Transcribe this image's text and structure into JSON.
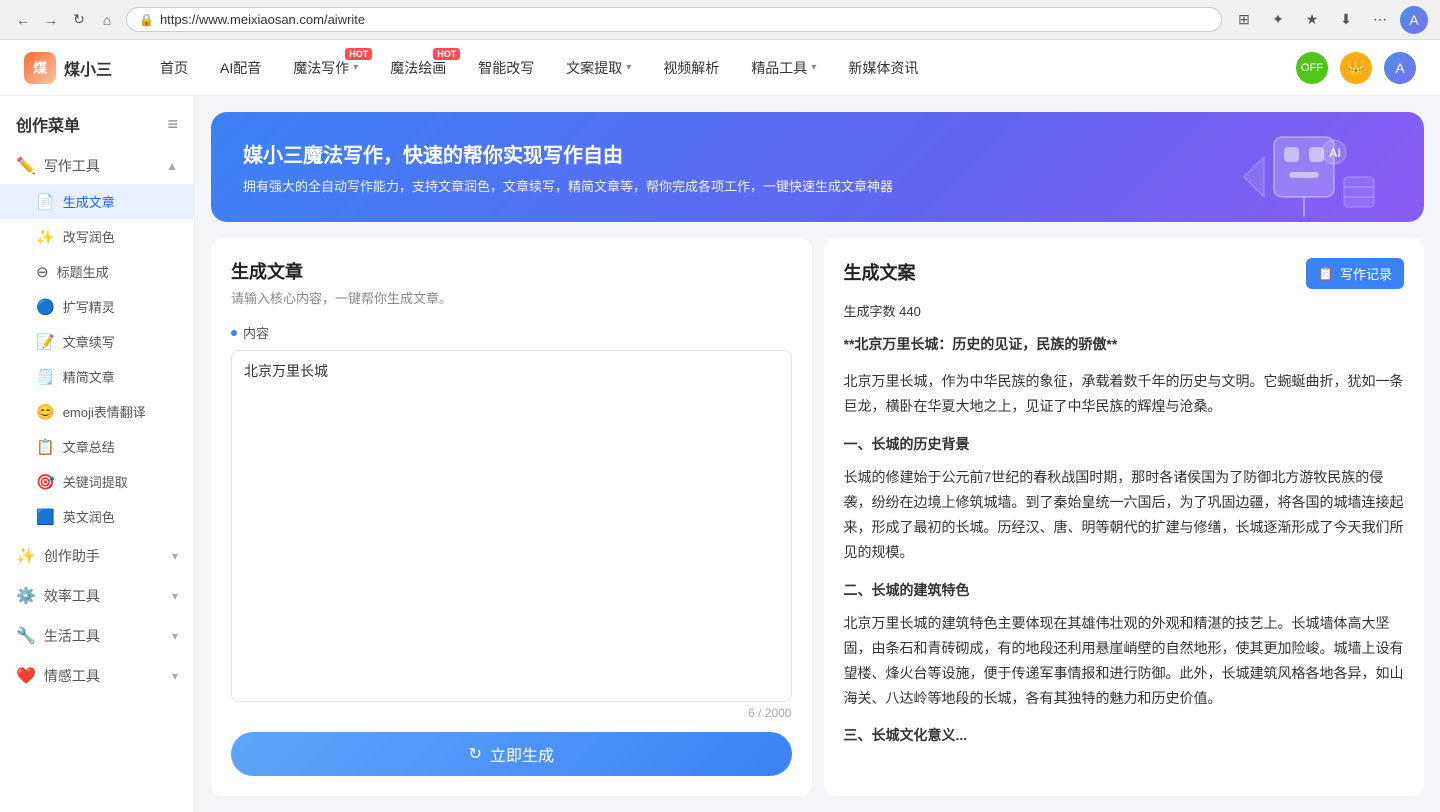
{
  "browser": {
    "url": "https://www.meixiaosan.com/aiwrite",
    "back_icon": "←",
    "forward_icon": "→",
    "refresh_icon": "↻",
    "home_icon": "⌂",
    "lock_icon": "🔒",
    "actions": [
      "⊞",
      "✦",
      "★",
      "⋯"
    ],
    "profile_icon": "A"
  },
  "header": {
    "logo_text": "煤小三",
    "logo_abbr": "煤",
    "nav_items": [
      {
        "label": "首页",
        "has_hot": false,
        "has_chevron": false
      },
      {
        "label": "AI配音",
        "has_hot": false,
        "has_chevron": false
      },
      {
        "label": "魔法写作",
        "has_hot": true,
        "has_chevron": true
      },
      {
        "label": "魔法绘画",
        "has_hot": true,
        "has_chevron": false
      },
      {
        "label": "智能改写",
        "has_hot": false,
        "has_chevron": false
      },
      {
        "label": "文案提取",
        "has_hot": false,
        "has_chevron": true
      },
      {
        "label": "视频解析",
        "has_hot": false,
        "has_chevron": false
      },
      {
        "label": "精品工具",
        "has_hot": false,
        "has_chevron": true
      },
      {
        "label": "新媒体资讯",
        "has_hot": false,
        "has_chevron": false
      }
    ],
    "hot_label": "HOT",
    "nav_right": {
      "green_badge": "OFF",
      "gold_icon": "👑",
      "avatar": "A"
    }
  },
  "sidebar": {
    "title": "创作菜单",
    "menu_icon": "≡",
    "sections": [
      {
        "label": "写作工具",
        "icon": "✏️",
        "expanded": true,
        "items": [
          {
            "label": "生成文章",
            "icon": "📄",
            "active": true
          },
          {
            "label": "改写润色",
            "icon": "✨"
          },
          {
            "label": "标题生成",
            "icon": "⊖"
          },
          {
            "label": "扩写精灵",
            "icon": "🔵"
          },
          {
            "label": "文章续写",
            "icon": "📝"
          },
          {
            "label": "精简文章",
            "icon": "🗒️"
          },
          {
            "label": "emoji表情翻译",
            "icon": "😊"
          },
          {
            "label": "文章总结",
            "icon": "📋"
          },
          {
            "label": "关键词提取",
            "icon": "🎯"
          },
          {
            "label": "英文润色",
            "icon": "🟦"
          }
        ]
      },
      {
        "label": "创作助手",
        "icon": "✨",
        "expanded": false,
        "items": []
      },
      {
        "label": "效率工具",
        "icon": "⚙️",
        "expanded": false,
        "items": []
      },
      {
        "label": "生活工具",
        "icon": "🔧",
        "expanded": false,
        "items": []
      },
      {
        "label": "情感工具",
        "icon": "❤️",
        "expanded": false,
        "items": []
      }
    ]
  },
  "banner": {
    "title": "媒小三魔法写作，快速的帮你实现写作自由",
    "subtitle": "拥有强大的全自动写作能力，支持文章润色，文章续写，精简文章等，帮你完成各项工作，一键快速生成文章神器"
  },
  "left_panel": {
    "title": "生成文章",
    "subtitle": "请输入核心内容，一键帮你生成文章。",
    "content_label": "内容",
    "input_value": "北京万里长城",
    "char_current": "6",
    "char_max": "2000",
    "generate_btn_label": "立即生成",
    "generate_icon": "↻"
  },
  "right_panel": {
    "title": "生成文案",
    "write_record_btn": "写作记录",
    "write_record_icon": "📋",
    "word_count_label": "生成字数",
    "word_count_value": "440",
    "article": {
      "heading": "**北京万里长城：历史的见证，民族的骄傲**",
      "paragraphs": [
        "北京万里长城，作为中华民族的象征，承载着数千年的历史与文明。它蜿蜒曲折，犹如一条巨龙，横卧在华夏大地之上，见证了中华民族的辉煌与沧桑。",
        "一、长城的历史背景",
        "长城的修建始于公元前7世纪的春秋战国时期，那时各诸侯国为了防御北方游牧民族的侵袭，纷纷在边境上修筑城墙。到了秦始皇统一六国后，为了巩固边疆，将各国的城墙连接起来，形成了最初的长城。历经汉、唐、明等朝代的扩建与修缮，长城逐渐形成了今天我们所见的规模。",
        "二、长城的建筑特色",
        "北京万里长城的建筑特色主要体现在其雄伟壮观的外观和精湛的技艺上。长城墙体高大坚固，由条石和青砖砌成，有的地段还利用悬崖峭壁的自然地形，使其更加险峻。城墙上设有望楼、烽火台等设施，便于传递军事情报和进行防御。此外，长城建筑风格各地各异，如山海关、八达岭等地段的长城，各有其独特的魅力和历史价值。",
        "三、长城文化意义..."
      ]
    }
  }
}
